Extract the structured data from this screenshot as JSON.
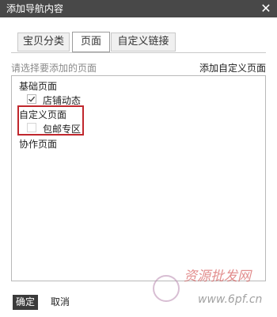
{
  "dialog": {
    "title": "添加导航内容",
    "close_glyph": "✕"
  },
  "tabs": [
    {
      "label": "宝贝分类",
      "active": false
    },
    {
      "label": "页面",
      "active": true
    },
    {
      "label": "自定义链接",
      "active": false
    }
  ],
  "hint": "请选择要添加的页面",
  "add_custom_page": "添加自定义页面",
  "groups": {
    "basic": {
      "label": "基础页面",
      "items": [
        {
          "label": "店铺动态",
          "checked": true
        }
      ]
    },
    "custom": {
      "label": "自定义页面",
      "items": [
        {
          "label": "包邮专区",
          "checked": false
        }
      ]
    },
    "collab": {
      "label": "协作页面",
      "items": []
    }
  },
  "buttons": {
    "ok": "确定",
    "cancel": "取消"
  },
  "watermark": {
    "text": "资源批发网",
    "url": "www.6pf.cn"
  },
  "colors": {
    "titlebar": "#484848",
    "highlight_border": "#c0272d",
    "ok_button": "#3b3b3b"
  }
}
